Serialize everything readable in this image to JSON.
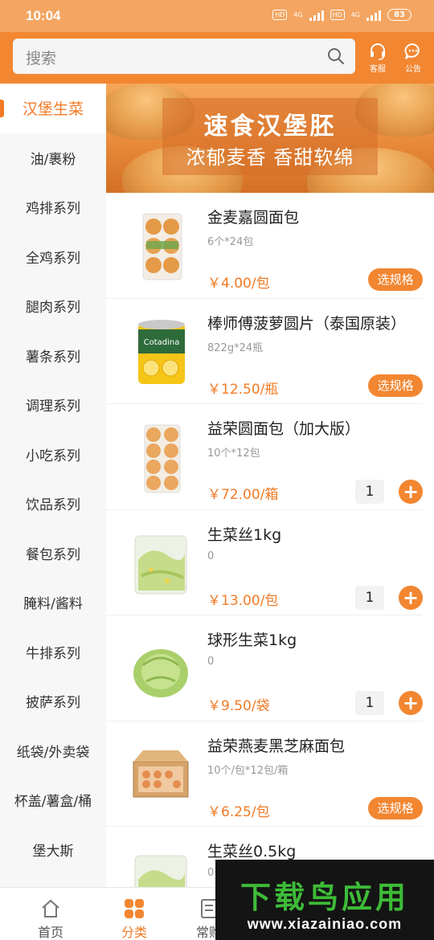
{
  "status_bar": {
    "time": "10:04",
    "hd_badge": "HD",
    "net_label": "4G",
    "battery": "83"
  },
  "header": {
    "search_placeholder": "搜索",
    "service_label": "客服",
    "notice_label": "公告",
    "accent_color": "#f28631"
  },
  "sidebar": {
    "categories": [
      {
        "label": "汉堡生菜",
        "active": true
      },
      {
        "label": "油/裹粉"
      },
      {
        "label": "鸡排系列"
      },
      {
        "label": "全鸡系列"
      },
      {
        "label": "腿肉系列"
      },
      {
        "label": "薯条系列"
      },
      {
        "label": "调理系列"
      },
      {
        "label": "小吃系列"
      },
      {
        "label": "饮品系列"
      },
      {
        "label": "餐包系列"
      },
      {
        "label": "腌料/酱料"
      },
      {
        "label": "牛排系列"
      },
      {
        "label": "披萨系列"
      },
      {
        "label": "纸袋/外卖袋"
      },
      {
        "label": "杯盖/薯盒/桶"
      },
      {
        "label": "堡大斯"
      }
    ]
  },
  "banner": {
    "title": "速食汉堡胚",
    "subtitle": "浓郁麦香 香甜软绵"
  },
  "products": [
    {
      "name": "金麦嘉圆面包",
      "spec": "6个*24包",
      "price": "￥4.00/包",
      "action": "选规格",
      "thumb_icon": "bun-pack-icon"
    },
    {
      "name": "棒师傅菠萝圆片（泰国原装）",
      "spec": "822g*24瓶",
      "price": "￥12.50/瓶",
      "action": "选规格",
      "thumb_icon": "pineapple-can-icon",
      "can_label": "Cotadina"
    },
    {
      "name": "益荣圆面包（加大版）",
      "spec": "10个*12包",
      "price": "￥72.00/箱",
      "qty": "1",
      "thumb_icon": "bun-pack-icon"
    },
    {
      "name": "生菜丝1kg",
      "spec": "0",
      "price": "￥13.00/包",
      "qty": "1",
      "thumb_icon": "lettuce-bag-icon"
    },
    {
      "name": "球形生菜1kg",
      "spec": "0",
      "price": "￥9.50/袋",
      "qty": "1",
      "thumb_icon": "lettuce-head-icon"
    },
    {
      "name": "益荣燕麦黑芝麻面包",
      "spec": "10个/包*12包/箱",
      "price": "￥6.25/包",
      "action": "选规格",
      "thumb_icon": "bread-box-icon"
    },
    {
      "name": "生菜丝0.5kg",
      "spec": "0",
      "price": "",
      "thumb_icon": "lettuce-bag-icon"
    }
  ],
  "bottom_nav": [
    {
      "label": "首页",
      "icon": "home-icon"
    },
    {
      "label": "分类",
      "icon": "category-grid-icon",
      "active": true
    },
    {
      "label": "常购",
      "icon": "list-icon"
    }
  ],
  "watermark": {
    "title": "下载鸟应用",
    "url": "www.xiazainiao.com"
  }
}
